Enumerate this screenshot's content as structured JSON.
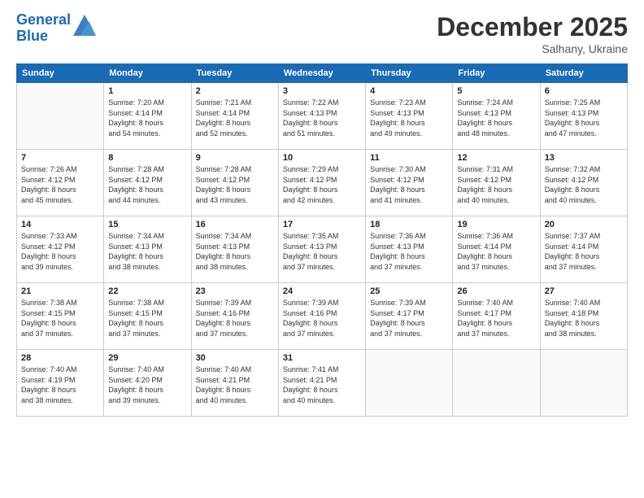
{
  "header": {
    "logo_line1": "General",
    "logo_line2": "Blue",
    "month": "December 2025",
    "location": "Salhany, Ukraine"
  },
  "weekdays": [
    "Sunday",
    "Monday",
    "Tuesday",
    "Wednesday",
    "Thursday",
    "Friday",
    "Saturday"
  ],
  "weeks": [
    [
      {
        "day": "",
        "info": ""
      },
      {
        "day": "1",
        "info": "Sunrise: 7:20 AM\nSunset: 4:14 PM\nDaylight: 8 hours\nand 54 minutes."
      },
      {
        "day": "2",
        "info": "Sunrise: 7:21 AM\nSunset: 4:14 PM\nDaylight: 8 hours\nand 52 minutes."
      },
      {
        "day": "3",
        "info": "Sunrise: 7:22 AM\nSunset: 4:13 PM\nDaylight: 8 hours\nand 51 minutes."
      },
      {
        "day": "4",
        "info": "Sunrise: 7:23 AM\nSunset: 4:13 PM\nDaylight: 8 hours\nand 49 minutes."
      },
      {
        "day": "5",
        "info": "Sunrise: 7:24 AM\nSunset: 4:13 PM\nDaylight: 8 hours\nand 48 minutes."
      },
      {
        "day": "6",
        "info": "Sunrise: 7:25 AM\nSunset: 4:13 PM\nDaylight: 8 hours\nand 47 minutes."
      }
    ],
    [
      {
        "day": "7",
        "info": "Sunrise: 7:26 AM\nSunset: 4:12 PM\nDaylight: 8 hours\nand 45 minutes."
      },
      {
        "day": "8",
        "info": "Sunrise: 7:28 AM\nSunset: 4:12 PM\nDaylight: 8 hours\nand 44 minutes."
      },
      {
        "day": "9",
        "info": "Sunrise: 7:28 AM\nSunset: 4:12 PM\nDaylight: 8 hours\nand 43 minutes."
      },
      {
        "day": "10",
        "info": "Sunrise: 7:29 AM\nSunset: 4:12 PM\nDaylight: 8 hours\nand 42 minutes."
      },
      {
        "day": "11",
        "info": "Sunrise: 7:30 AM\nSunset: 4:12 PM\nDaylight: 8 hours\nand 41 minutes."
      },
      {
        "day": "12",
        "info": "Sunrise: 7:31 AM\nSunset: 4:12 PM\nDaylight: 8 hours\nand 40 minutes."
      },
      {
        "day": "13",
        "info": "Sunrise: 7:32 AM\nSunset: 4:12 PM\nDaylight: 8 hours\nand 40 minutes."
      }
    ],
    [
      {
        "day": "14",
        "info": "Sunrise: 7:33 AM\nSunset: 4:12 PM\nDaylight: 8 hours\nand 39 minutes."
      },
      {
        "day": "15",
        "info": "Sunrise: 7:34 AM\nSunset: 4:13 PM\nDaylight: 8 hours\nand 38 minutes."
      },
      {
        "day": "16",
        "info": "Sunrise: 7:34 AM\nSunset: 4:13 PM\nDaylight: 8 hours\nand 38 minutes."
      },
      {
        "day": "17",
        "info": "Sunrise: 7:35 AM\nSunset: 4:13 PM\nDaylight: 8 hours\nand 37 minutes."
      },
      {
        "day": "18",
        "info": "Sunrise: 7:36 AM\nSunset: 4:13 PM\nDaylight: 8 hours\nand 37 minutes."
      },
      {
        "day": "19",
        "info": "Sunrise: 7:36 AM\nSunset: 4:14 PM\nDaylight: 8 hours\nand 37 minutes."
      },
      {
        "day": "20",
        "info": "Sunrise: 7:37 AM\nSunset: 4:14 PM\nDaylight: 8 hours\nand 37 minutes."
      }
    ],
    [
      {
        "day": "21",
        "info": "Sunrise: 7:38 AM\nSunset: 4:15 PM\nDaylight: 8 hours\nand 37 minutes."
      },
      {
        "day": "22",
        "info": "Sunrise: 7:38 AM\nSunset: 4:15 PM\nDaylight: 8 hours\nand 37 minutes."
      },
      {
        "day": "23",
        "info": "Sunrise: 7:39 AM\nSunset: 4:16 PM\nDaylight: 8 hours\nand 37 minutes."
      },
      {
        "day": "24",
        "info": "Sunrise: 7:39 AM\nSunset: 4:16 PM\nDaylight: 8 hours\nand 37 minutes."
      },
      {
        "day": "25",
        "info": "Sunrise: 7:39 AM\nSunset: 4:17 PM\nDaylight: 8 hours\nand 37 minutes."
      },
      {
        "day": "26",
        "info": "Sunrise: 7:40 AM\nSunset: 4:17 PM\nDaylight: 8 hours\nand 37 minutes."
      },
      {
        "day": "27",
        "info": "Sunrise: 7:40 AM\nSunset: 4:18 PM\nDaylight: 8 hours\nand 38 minutes."
      }
    ],
    [
      {
        "day": "28",
        "info": "Sunrise: 7:40 AM\nSunset: 4:19 PM\nDaylight: 8 hours\nand 38 minutes."
      },
      {
        "day": "29",
        "info": "Sunrise: 7:40 AM\nSunset: 4:20 PM\nDaylight: 8 hours\nand 39 minutes."
      },
      {
        "day": "30",
        "info": "Sunrise: 7:40 AM\nSunset: 4:21 PM\nDaylight: 8 hours\nand 40 minutes."
      },
      {
        "day": "31",
        "info": "Sunrise: 7:41 AM\nSunset: 4:21 PM\nDaylight: 8 hours\nand 40 minutes."
      },
      {
        "day": "",
        "info": ""
      },
      {
        "day": "",
        "info": ""
      },
      {
        "day": "",
        "info": ""
      }
    ]
  ]
}
